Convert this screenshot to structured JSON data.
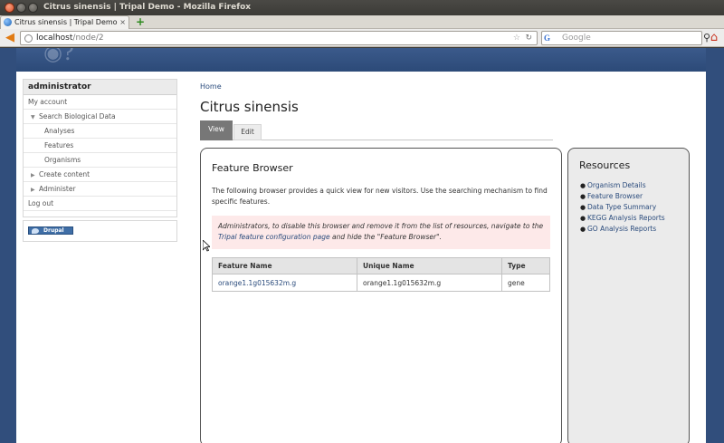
{
  "window": {
    "title": "Citrus sinensis | Tripal Demo - Mozilla Firefox"
  },
  "browser": {
    "tab_label": "Citrus sinensis | Tripal Demo",
    "tab_close": "×",
    "new_tab": "+",
    "url_host": "localhost",
    "url_path": "/node/2",
    "search_placeholder": "Google",
    "star": "☆",
    "reload": "↻"
  },
  "sidebar": {
    "block_title": "administrator",
    "menu": [
      {
        "label": "My account",
        "level": 0,
        "arrow": ""
      },
      {
        "label": "Search Biological Data",
        "level": 1,
        "arrow": "▼"
      },
      {
        "label": "Analyses",
        "level": 2,
        "arrow": ""
      },
      {
        "label": "Features",
        "level": 2,
        "arrow": ""
      },
      {
        "label": "Organisms",
        "level": 2,
        "arrow": ""
      },
      {
        "label": "Create content",
        "level": 1,
        "arrow": "▶"
      },
      {
        "label": "Administer",
        "level": 1,
        "arrow": "▶"
      },
      {
        "label": "Log out",
        "level": 0,
        "arrow": ""
      }
    ],
    "drupal_badge": "Drupal"
  },
  "main": {
    "breadcrumb": "Home",
    "title": "Citrus sinensis",
    "tabs": [
      {
        "label": "View"
      },
      {
        "label": "Edit"
      }
    ],
    "feature_browser": {
      "title": "Feature Browser",
      "description": "The following browser provides a quick view for new visitors. Use the searching mechanism to find specific features.",
      "notice_before": "Administrators, to disable this browser and remove it from the list of resources, navigate to the ",
      "notice_link": "Tripal feature configuration page",
      "notice_after": " and hide the \"Feature Browser\".",
      "columns": [
        "Feature Name",
        "Unique Name",
        "Type"
      ],
      "rows": [
        {
          "feature_name": "orange1.1g015632m.g",
          "unique_name": "orange1.1g015632m.g",
          "type": "gene"
        }
      ]
    },
    "resources": {
      "title": "Resources",
      "items": [
        "Organism Details",
        "Feature Browser",
        "Data Type Summary",
        "KEGG Analysis Reports",
        "GO Analysis Reports"
      ]
    }
  },
  "colors": {
    "link": "#2a4b7c",
    "header_band": "#314e7c",
    "notice_bg": "#fde9e9",
    "tab_active": "#777777"
  }
}
